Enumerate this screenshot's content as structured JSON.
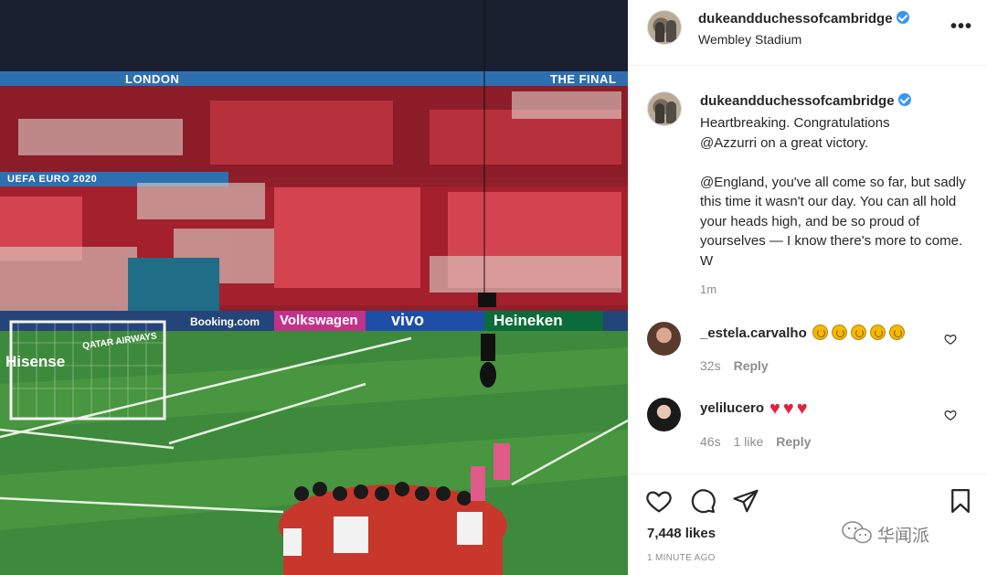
{
  "photo": {
    "banner_left": "LONDON",
    "banner_right": "THE FINAL",
    "euro_label": "UEFA EURO 2020",
    "ads": [
      "Booking.com",
      "Volkswagen",
      "vivo",
      "Heineken",
      "Hisense",
      "QATAR AIRWAYS"
    ],
    "colors": {
      "turf": "#3f8a3a",
      "seats": "#a3202c",
      "board": "#2c4b6e"
    }
  },
  "post": {
    "username": "dukeandduchessofcambridge",
    "location": "Wembley Stadium",
    "caption": "Heartbreaking. Congratulations\n@Azzurri on a great victory.\n\n@England, you've all come so far, but sadly this time it wasn't our day. You can all hold your heads high, and be so proud of yourselves — I know there's more to come. W",
    "time": "1m",
    "likes": "7,448 likes",
    "time_ago": "1 MINUTE AGO"
  },
  "comments": [
    {
      "username": "_estela.carvalho",
      "emoji_count": 5,
      "time": "32s",
      "likes": "",
      "reply": "Reply"
    },
    {
      "username": "yelilucero",
      "hearts": 3,
      "time": "46s",
      "likes": "1 like",
      "reply": "Reply"
    }
  ],
  "watermark": {
    "text": "华闻派"
  },
  "icons": [
    "more-icon",
    "verified-icon",
    "heart-icon",
    "comment-icon",
    "share-icon",
    "bookmark-icon"
  ]
}
